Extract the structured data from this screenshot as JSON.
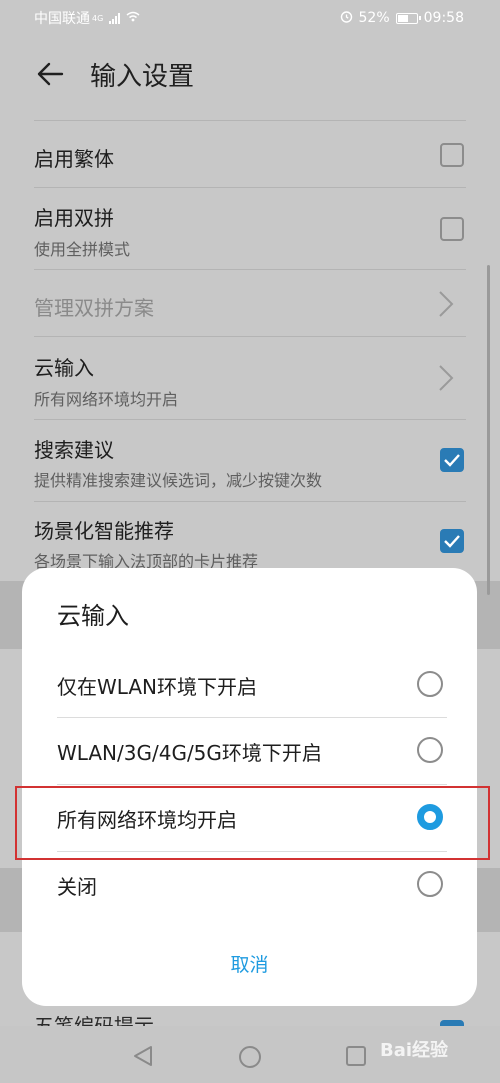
{
  "status_bar": {
    "carrier": "中国联通",
    "network": "4G",
    "battery": "52%",
    "time": "09:58"
  },
  "header": {
    "title": "输入设置"
  },
  "settings": [
    {
      "title": "启用繁体",
      "subtitle": "",
      "control": "checkbox",
      "checked": false
    },
    {
      "title": "启用双拼",
      "subtitle": "使用全拼模式",
      "control": "checkbox",
      "checked": false
    },
    {
      "title": "管理双拼方案",
      "subtitle": "",
      "control": "chevron",
      "disabled": true
    },
    {
      "title": "云输入",
      "subtitle": "所有网络环境均开启",
      "control": "chevron"
    },
    {
      "title": "搜索建议",
      "subtitle": "提供精准搜索建议候选词，减少按键次数",
      "control": "checkbox",
      "checked": true
    },
    {
      "title": "场景化智能推荐",
      "subtitle": "各场景下输入法顶部的卡片推荐",
      "control": "checkbox",
      "checked": true
    },
    {
      "title": "五笔编码提示",
      "subtitle": "",
      "control": "checkbox",
      "checked": true
    }
  ],
  "dialog": {
    "title": "云输入",
    "options": [
      {
        "label": "仅在WLAN环境下开启",
        "selected": false
      },
      {
        "label": "WLAN/3G/4G/5G环境下开启",
        "selected": false
      },
      {
        "label": "所有网络环境均开启",
        "selected": true
      },
      {
        "label": "关闭",
        "selected": false
      }
    ],
    "cancel_label": "取消"
  },
  "watermark": "Bai经验",
  "colors": {
    "accent": "#1e9be0",
    "checkbox_checked": "#2a7bb5",
    "highlight_border": "#d23232",
    "dimmed_background": "#c8c8c8"
  }
}
